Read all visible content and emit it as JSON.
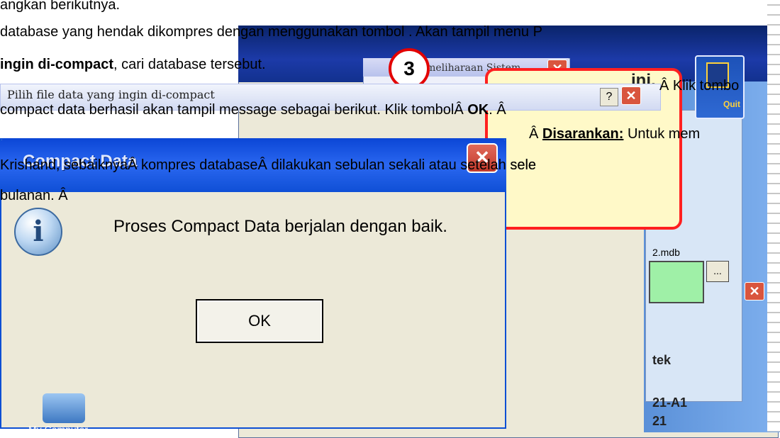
{
  "article": {
    "line1": "angkan berikutnya.",
    "line2": "database yang hendak dikompres dengan menggunakan tombol . Akan tampil menu P",
    "line3_bold": "ingin di-compact",
    "line3_rest": ", cari database tersebut.",
    "line4": "compact data berhasil akan tampil message sebagai berikut. Klik tombolÂ ",
    "line4_ok": "OK",
    "line4_end": ".  Â",
    "klik_tombol": "Â   Klik tombo",
    "saran_label": "Disarankan:",
    "saran_rest": " Untuk mem",
    "line6": "Krishand, sebaiknyaÂ kompres databaseÂ dilakukan sebulan sekali atau setelah sele",
    "line7": "bulanan.  Â"
  },
  "background": {
    "step_number": "3",
    "small_dialog_title": "Pemeliharaan Sistem",
    "pilih_title": "Pilih file data yang ingin di-compact",
    "callout_text": "ini,",
    "filename": "2.mdb",
    "browse_label": "...",
    "quit_label": "Quit",
    "labels": [
      "tek",
      "21-A1",
      "21"
    ],
    "accent_a": "Â",
    "help_label": "?",
    "close_label": "✕",
    "mycomputer_label": "My Computer"
  },
  "dialog": {
    "title": "Compact Data",
    "message": "Proses Compact Data berjalan dengan baik.",
    "ok_label": "OK",
    "close_label": "✕",
    "icon": "info-icon"
  }
}
